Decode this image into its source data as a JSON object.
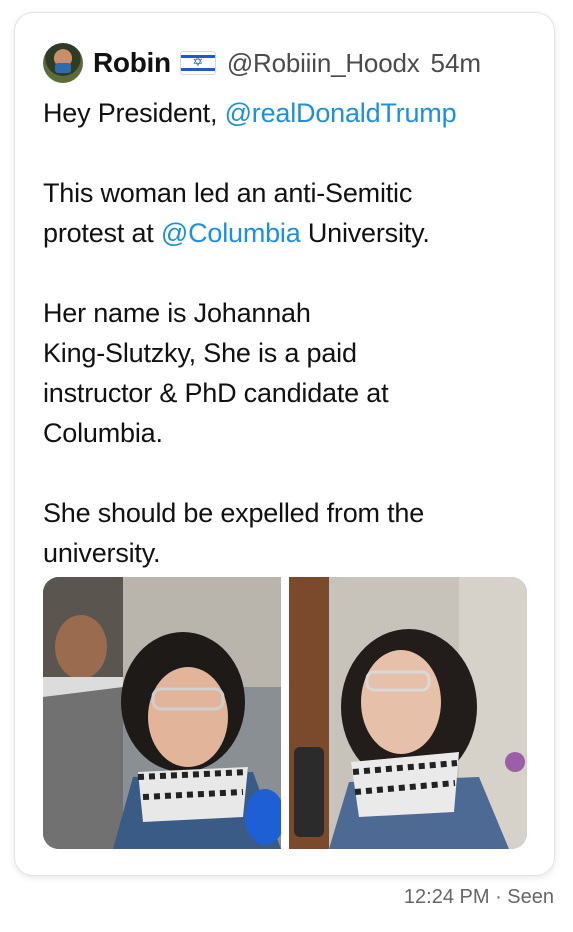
{
  "tweet": {
    "author_name": "Robin",
    "flag_icon": "israel-flag-icon",
    "handle": "@Robiiin_Hoodx",
    "time_ago": "54m",
    "line1_text": "Hey President, ",
    "mention_trump": "@realDonaldTrump",
    "para2_line1": "This woman led an anti-Semitic",
    "para2_line2_pre": "protest at ",
    "mention_columbia": "@Columbia",
    "para2_line2_post": " University.",
    "para3_line1": "Her name is Johannah",
    "para3_line2": "King-Slutzky, She is a paid",
    "para3_line3": "instructor & PhD candidate at",
    "para3_line4": "Columbia.",
    "para4_line1": "She should be expelled from the",
    "para4_line2": "university.",
    "media": [
      {
        "icon": "photo-woman-protest-1"
      },
      {
        "icon": "photo-woman-protest-2"
      }
    ]
  },
  "footer": {
    "status": "12:24 PM · Seen"
  },
  "colors": {
    "mention": "#1d8fe0",
    "text": "#111111",
    "muted": "#4b4b4b"
  }
}
